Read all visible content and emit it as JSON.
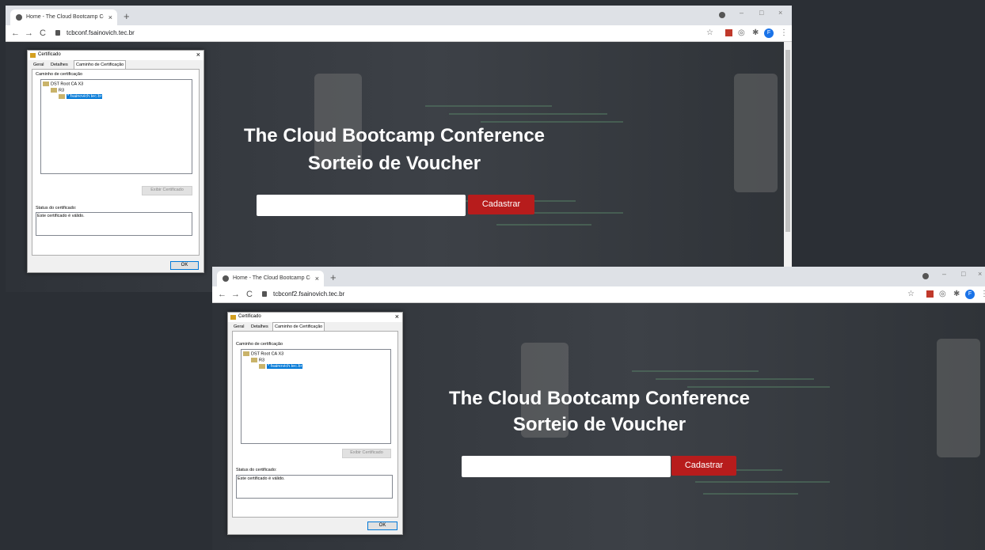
{
  "browser1": {
    "tab_title": "Home - The Cloud Bootcamp Co",
    "url": "tcbconf.fsainovich.tec.br",
    "avatar_letter": "F",
    "page_title": "The Cloud Bootcamp Conference",
    "page_subtitle": "Sorteio de Voucher",
    "submit_label": "Cadastrar"
  },
  "browser2": {
    "tab_title": "Home - The Cloud Bootcamp Co",
    "url": "tcbconf2.fsainovich.tec.br",
    "avatar_letter": "F",
    "page_title": "The Cloud Bootcamp Conference",
    "page_subtitle": "Sorteio de Voucher",
    "submit_label": "Cadastrar"
  },
  "dialog": {
    "title": "Certificado",
    "tabs": [
      "Geral",
      "Detalhes",
      "Caminho de Certificação"
    ],
    "path_label": "Caminho de certificação",
    "tree": [
      "DST Root CA X3",
      "R3",
      "*.fsainovich.tec.br"
    ],
    "view_button": "Exibir Certificado",
    "status_label": "Status do certificado:",
    "status_text": "Este certificado é válido.",
    "ok_label": "OK"
  },
  "icons": {
    "tab_close": "×",
    "new_tab": "+",
    "back": "←",
    "forward": "→",
    "reload": "C",
    "star": "☆",
    "minimize": "–",
    "maximize": "□",
    "close": "×",
    "puzzle": "✱",
    "menu": "⋮",
    "shield": "◎"
  },
  "colors": {
    "accent_button": "#b71c1c",
    "selection": "#0078d7",
    "page_bg": "#2b2f35"
  }
}
